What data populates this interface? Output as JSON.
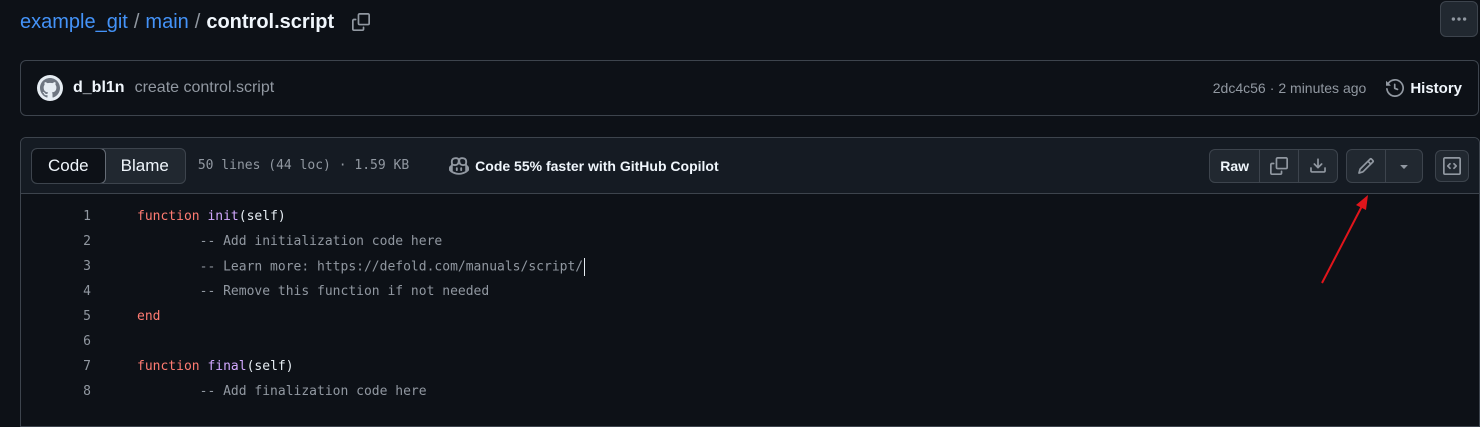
{
  "breadcrumb": {
    "repo": "example_git",
    "branch": "main",
    "file": "control.script",
    "sep": "/"
  },
  "commit": {
    "author": "d_bl1n",
    "message": "create control.script",
    "hash": "2dc4c56",
    "dot": "·",
    "time": "2 minutes ago",
    "history_label": "History"
  },
  "file_header": {
    "tabs": [
      "Code",
      "Blame"
    ],
    "active_tab": "Code",
    "meta": "50 lines (44 loc) · 1.59 KB",
    "copilot": "Code 55% faster with GitHub Copilot",
    "raw_label": "Raw"
  },
  "code_lines": [
    {
      "num": "1",
      "parts": [
        [
          "kw",
          "function"
        ],
        [
          "t",
          " "
        ],
        [
          "fn",
          "init"
        ],
        [
          "t",
          "(self)"
        ]
      ]
    },
    {
      "num": "2",
      "parts": [
        [
          "cm",
          "        -- Add initialization code here"
        ]
      ]
    },
    {
      "num": "3",
      "parts": [
        [
          "cm",
          "        -- Learn more: https://defold.com/manuals/script/"
        ]
      ],
      "caret": true
    },
    {
      "num": "4",
      "parts": [
        [
          "cm",
          "        -- Remove this function if not needed"
        ]
      ]
    },
    {
      "num": "5",
      "parts": [
        [
          "kw",
          "end"
        ]
      ]
    },
    {
      "num": "6",
      "parts": []
    },
    {
      "num": "7",
      "parts": [
        [
          "kw",
          "function"
        ],
        [
          "t",
          " "
        ],
        [
          "fn",
          "final"
        ],
        [
          "t",
          "(self)"
        ]
      ]
    },
    {
      "num": "8",
      "parts": [
        [
          "cm",
          "        -- Add finalization code here"
        ]
      ]
    }
  ],
  "colors": {
    "link": "#4493f8",
    "keyword": "#ff7b72",
    "function": "#d2a8ff",
    "annotation_arrow": "#e0151b"
  }
}
